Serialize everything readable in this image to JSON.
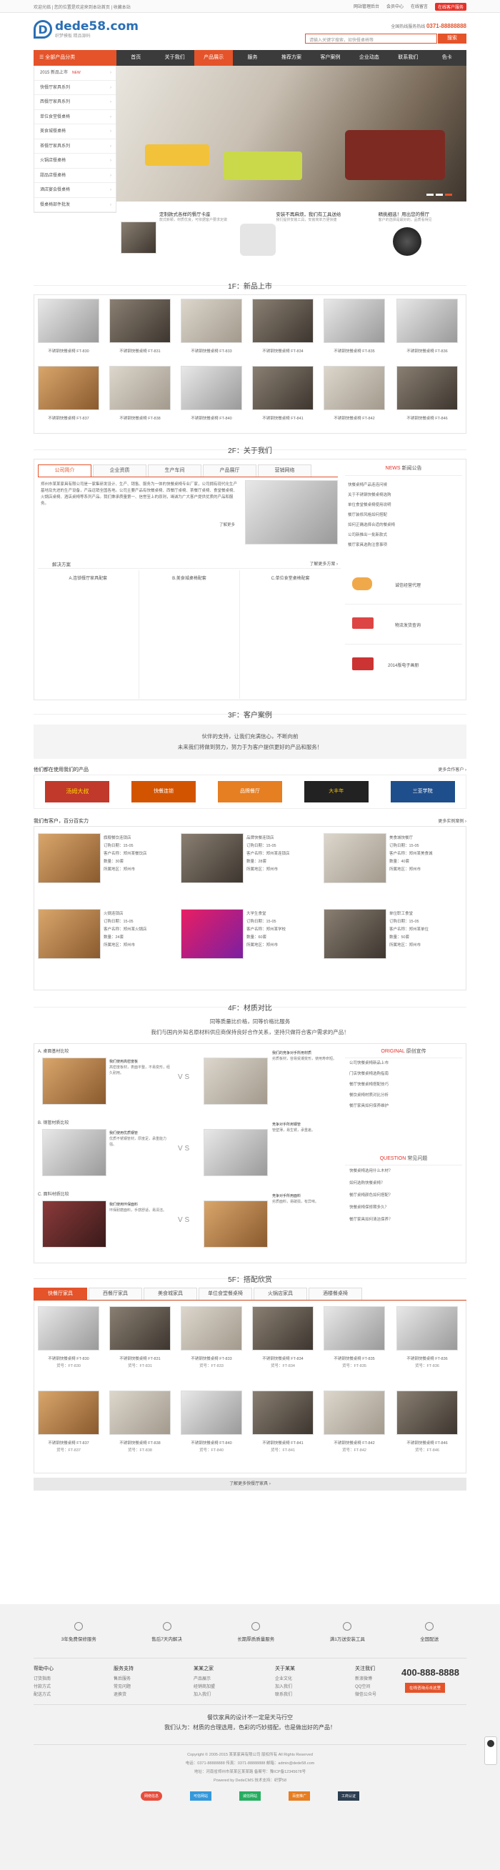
{
  "topbar": {
    "left": "欢迎光临 | 您的位置是欢迎来到本站首页 | 收藏本站",
    "links": [
      "网站管理后台",
      "会员中心",
      "在线留言"
    ],
    "cta": "在线客户服务"
  },
  "header": {
    "logo_main": "dede58.com",
    "logo_sub": "织梦模板 精品源码",
    "phone_label": "全国热线服务热线",
    "phone": "0371-88888888",
    "search_placeholder": "请输入关键字搜索，如快餐桌椅等",
    "search_btn": "搜索"
  },
  "nav": {
    "category": "全部产品分类",
    "items": [
      "首页",
      "关于我们",
      "产品展示",
      "服务",
      "推荐方案",
      "客户案例",
      "企业动态",
      "联系我们",
      "色卡"
    ],
    "active": 2
  },
  "sidebar": [
    {
      "label": "2015 新品上市",
      "new": "NEW"
    },
    {
      "label": "快餐厅家具系列"
    },
    {
      "label": "西餐厅家具系列"
    },
    {
      "label": "单位食堂餐桌椅"
    },
    {
      "label": "美食城餐桌椅"
    },
    {
      "label": "茶餐厅家具系列"
    },
    {
      "label": "火锅店餐桌椅"
    },
    {
      "label": "甜品店餐桌椅"
    },
    {
      "label": "酒店宴会餐桌椅"
    },
    {
      "label": "餐桌椅部件批发"
    }
  ],
  "features": [
    {
      "title": "定制款式各样的餐厅卡座",
      "desc": "款式新颖，材质优良，可依据客户要求定做"
    },
    {
      "title": "安装不再麻烦，我们有工具送给",
      "desc": "我们提供安装工具，安装简单方便快捷"
    },
    {
      "title": "精挑细选！用出您的餐厅",
      "desc": "客户的选择是最好的，品质看得见"
    }
  ],
  "s1": {
    "title": "1F：新品上市",
    "products": [
      {
        "name": "不锈钢快餐桌椅 FT-830"
      },
      {
        "name": "不锈钢快餐桌椅 FT-831"
      },
      {
        "name": "不锈钢快餐桌椅 FT-833"
      },
      {
        "name": "不锈钢快餐桌椅 FT-834"
      },
      {
        "name": "不锈钢快餐桌椅 FT-835"
      },
      {
        "name": "不锈钢快餐桌椅 FT-836"
      },
      {
        "name": "不锈钢快餐桌椅 FT-837"
      },
      {
        "name": "不锈钢快餐桌椅 FT-838"
      },
      {
        "name": "不锈钢快餐桌椅 FT-840"
      },
      {
        "name": "不锈钢快餐桌椅 FT-841"
      },
      {
        "name": "不锈钢快餐桌椅 FT-842"
      },
      {
        "name": "不锈钢快餐桌椅 FT-846"
      }
    ]
  },
  "s2": {
    "title": "2F：关于我们",
    "tabs": [
      "公司简介",
      "企业资质",
      "生产车间",
      "产品展厅",
      "营销网络"
    ],
    "intro": "郑州市某某家具有限公司是一家集研发设计、生产、销售、服务为一体的快餐桌椅专业厂家，公司拥有现代化生产基地及先进的生产设备，产品远销全国各地。公司主要产品有快餐桌椅、西餐厅桌椅、茶餐厅桌椅、食堂餐桌椅、火锅店桌椅、酒店桌椅等系列产品。我们秉承质量第一、信誉至上的原则，竭诚为广大客户提供优质的产品和服务。",
    "more": "了解更多",
    "news_title": "NEWS",
    "news_sub": "新闻公告",
    "news": [
      "快餐桌椅产品连连问候",
      "关于不锈钢快餐桌椅选购",
      "单位食堂餐桌椅使用说明",
      "餐厅装修风格如何搭配",
      "如何正确选择合适的餐桌椅",
      "公司新推出一批新款式",
      "餐厅家具选购注意事项"
    ],
    "plan_title": "解决方案",
    "plan_more": "了解更多方案 ›",
    "plans": [
      "A.连锁餐厅家具配套",
      "B.美食城桌椅配套",
      "C.单位食堂桌椅配套"
    ],
    "services": [
      "诚信经营代理",
      "物流发货查询",
      "2014版电子画册"
    ]
  },
  "s3": {
    "title": "3F：客户案例",
    "slogan1": "伙伴的支持，让我们充满信心，不断向前",
    "slogan2": "未来我们将做到努力，努力于为客户提供更好的产品和服务！",
    "using_title": "他们都在使用我们的产品",
    "using_more": "更多合作客户 ›",
    "brands": [
      "汤姆大叔",
      "快餐连锁",
      "品牌餐厅",
      "大丰年",
      "三亚学院"
    ],
    "cases_title": "我们有客户，百分百实力",
    "cases_more": "更多实例案例 ›",
    "cases": [
      {
        "name": "旗舰餐饮连锁店",
        "l1": "订购日期：15-05",
        "l2": "客户名称：郑州某餐饮店",
        "l3": "数量：30套",
        "l4": "所属地区：郑州市"
      },
      {
        "name": "品牌快餐连锁店",
        "l1": "订购日期：15-05",
        "l2": "客户名称：郑州某连锁店",
        "l3": "数量：28套",
        "l4": "所属地区：郑州市"
      },
      {
        "name": "美食城快餐厅",
        "l1": "订购日期：15-05",
        "l2": "客户名称：郑州某美食城",
        "l3": "数量：40套",
        "l4": "所属地区：郑州市"
      },
      {
        "name": "火锅连锁店",
        "l1": "订购日期：15-05",
        "l2": "客户名称：郑州某火锅店",
        "l3": "数量：24套",
        "l4": "所属地区：郑州市"
      },
      {
        "name": "大学生食堂",
        "l1": "订购日期：15-05",
        "l2": "客户名称：郑州某学校",
        "l3": "数量：60套",
        "l4": "所属地区：郑州市"
      },
      {
        "name": "单位职工食堂",
        "l1": "订购日期：15-05",
        "l2": "客户名称：郑州某单位",
        "l3": "数量：50套",
        "l4": "所属地区：郑州市"
      }
    ]
  },
  "s4": {
    "title": "4F：材质对比",
    "slogan1": "同等质量比价格，同等价格比服务",
    "slogan2": "我们与国内外知名原材料供应商保持良好合作关系，坚持只做符合客户需求的产品！",
    "compares": [
      {
        "label": "A. 桌面基材比较",
        "good": "我们使用高密度板",
        "good_desc": "高密度板材，表面平整，不易变形，经久耐用。",
        "bad": "我们的竞争对手所用材质",
        "bad_desc": "劣质板材，容易受潮变形，使用寿命短。"
      },
      {
        "label": "B. 钢管材质比较",
        "good": "我们使用优质钢管",
        "good_desc": "优质不锈钢管材，厚度足，承重能力强。",
        "bad": "竞争对手所用钢管",
        "bad_desc": "管壁薄，易生锈，承重差。"
      },
      {
        "label": "C. 面料材质比较",
        "good": "我们使用环保面料",
        "good_desc": "环保耐磨面料，手感舒适，易清洁。",
        "bad": "竞争对手所用面料",
        "bad_desc": "劣质面料，易破损，有异味。"
      }
    ],
    "vs": "V S",
    "orig_title": "ORIGINAL",
    "orig_sub": "原创宣传",
    "orig": [
      "公司快餐桌椅新品上市",
      "门店快餐桌椅选购指南",
      "餐厅快餐桌椅搭配技巧",
      "餐饮桌椅材质对比分析",
      "餐厅家具如何保养维护"
    ],
    "q_title": "QUESTION",
    "q_sub": "常见问题",
    "qs": [
      "快餐桌椅选用什么木材？",
      "如何选购快餐桌椅？",
      "餐厅桌椅颜色如何搭配？",
      "快餐桌椅保修期多久？",
      "餐厅家具如何清洁保养？"
    ]
  },
  "s5": {
    "title": "5F：搭配欣赏",
    "tabs": [
      "快餐厅家具",
      "西餐厅家具",
      "美食城家具",
      "单位食堂餐桌椅",
      "火锅店家具",
      "酒楼餐桌椅"
    ],
    "products": [
      {
        "name": "不锈钢快餐桌椅 FT-830",
        "code": "货号：FT-830"
      },
      {
        "name": "不锈钢快餐桌椅 FT-831",
        "code": "货号：FT-831"
      },
      {
        "name": "不锈钢快餐桌椅 FT-833",
        "code": "货号：FT-833"
      },
      {
        "name": "不锈钢快餐桌椅 FT-834",
        "code": "货号：FT-834"
      },
      {
        "name": "不锈钢快餐桌椅 FT-835",
        "code": "货号：FT-835"
      },
      {
        "name": "不锈钢快餐桌椅 FT-836",
        "code": "货号：FT-836"
      },
      {
        "name": "不锈钢快餐桌椅 FT-837",
        "code": "货号：FT-837"
      },
      {
        "name": "不锈钢快餐桌椅 FT-838",
        "code": "货号：FT-838"
      },
      {
        "name": "不锈钢快餐桌椅 FT-840",
        "code": "货号：FT-840"
      },
      {
        "name": "不锈钢快餐桌椅 FT-841",
        "code": "货号：FT-841"
      },
      {
        "name": "不锈钢快餐桌椅 FT-842",
        "code": "货号：FT-842"
      },
      {
        "name": "不锈钢快餐桌椅 FT-846",
        "code": "货号：FT-846"
      }
    ],
    "more": "了解更多快餐厅家具 ›"
  },
  "footer": {
    "badges": [
      "3年免费保修服务",
      "售后7天内解决",
      "长期厚质质量服务",
      "满1万送安装工具",
      "全国配送"
    ],
    "cols": [
      {
        "title": "帮助中心",
        "items": [
          "订货指南",
          "付款方式",
          "配送方式"
        ]
      },
      {
        "title": "服务支持",
        "items": [
          "售后服务",
          "常见问题",
          "退换货"
        ]
      },
      {
        "title": "某某之家",
        "items": [
          "产品展示",
          "经销商加盟",
          "加入我们"
        ]
      },
      {
        "title": "关于某某",
        "items": [
          "企业文化",
          "加入我们",
          "联系我们"
        ]
      },
      {
        "title": "关注我们",
        "items": [
          "新浪微博",
          "QQ空间",
          "微信公众号"
        ]
      }
    ],
    "phone": "400-888-8888",
    "phone_btn": "在线咨询点击这里",
    "motto1": "餐饮家具的设计不一定是天马行空",
    "motto2": "我们认为：材质的合理选用，色彩的巧妙搭配，也是做出好的产品！",
    "copy1": "Copyright © 2005-2015 某某家具有限公司 版权所有 All Rights Reserved",
    "copy2": "电话：0371-88888888 传真：0371-88888888 邮箱：admin@dede58.com",
    "copy3": "地址：河南省郑州市某某区某某路 备案号：豫ICP备12345678号",
    "copy4": "Powered by DedeCMS 技术支持：织梦58",
    "partners": [
      "网络信息",
      "可信网站",
      "诚信网站",
      "百度推广",
      "工商认证"
    ]
  }
}
